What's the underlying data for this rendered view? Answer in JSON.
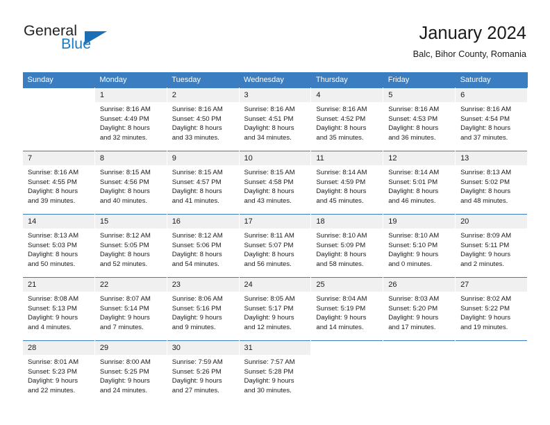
{
  "brand": {
    "name_dark": "General",
    "name_blue": "Blue",
    "accent_color": "#1c7bc0",
    "header_color": "#3a7dc0"
  },
  "header": {
    "title": "January 2024",
    "subtitle": "Balc, Bihor County, Romania"
  },
  "weekdays": [
    "Sunday",
    "Monday",
    "Tuesday",
    "Wednesday",
    "Thursday",
    "Friday",
    "Saturday"
  ],
  "weeks": [
    [
      {
        "day": "",
        "sunrise": "",
        "sunset": "",
        "daylight1": "",
        "daylight2": ""
      },
      {
        "day": "1",
        "sunrise": "Sunrise: 8:16 AM",
        "sunset": "Sunset: 4:49 PM",
        "daylight1": "Daylight: 8 hours",
        "daylight2": "and 32 minutes."
      },
      {
        "day": "2",
        "sunrise": "Sunrise: 8:16 AM",
        "sunset": "Sunset: 4:50 PM",
        "daylight1": "Daylight: 8 hours",
        "daylight2": "and 33 minutes."
      },
      {
        "day": "3",
        "sunrise": "Sunrise: 8:16 AM",
        "sunset": "Sunset: 4:51 PM",
        "daylight1": "Daylight: 8 hours",
        "daylight2": "and 34 minutes."
      },
      {
        "day": "4",
        "sunrise": "Sunrise: 8:16 AM",
        "sunset": "Sunset: 4:52 PM",
        "daylight1": "Daylight: 8 hours",
        "daylight2": "and 35 minutes."
      },
      {
        "day": "5",
        "sunrise": "Sunrise: 8:16 AM",
        "sunset": "Sunset: 4:53 PM",
        "daylight1": "Daylight: 8 hours",
        "daylight2": "and 36 minutes."
      },
      {
        "day": "6",
        "sunrise": "Sunrise: 8:16 AM",
        "sunset": "Sunset: 4:54 PM",
        "daylight1": "Daylight: 8 hours",
        "daylight2": "and 37 minutes."
      }
    ],
    [
      {
        "day": "7",
        "sunrise": "Sunrise: 8:16 AM",
        "sunset": "Sunset: 4:55 PM",
        "daylight1": "Daylight: 8 hours",
        "daylight2": "and 39 minutes."
      },
      {
        "day": "8",
        "sunrise": "Sunrise: 8:15 AM",
        "sunset": "Sunset: 4:56 PM",
        "daylight1": "Daylight: 8 hours",
        "daylight2": "and 40 minutes."
      },
      {
        "day": "9",
        "sunrise": "Sunrise: 8:15 AM",
        "sunset": "Sunset: 4:57 PM",
        "daylight1": "Daylight: 8 hours",
        "daylight2": "and 41 minutes."
      },
      {
        "day": "10",
        "sunrise": "Sunrise: 8:15 AM",
        "sunset": "Sunset: 4:58 PM",
        "daylight1": "Daylight: 8 hours",
        "daylight2": "and 43 minutes."
      },
      {
        "day": "11",
        "sunrise": "Sunrise: 8:14 AM",
        "sunset": "Sunset: 4:59 PM",
        "daylight1": "Daylight: 8 hours",
        "daylight2": "and 45 minutes."
      },
      {
        "day": "12",
        "sunrise": "Sunrise: 8:14 AM",
        "sunset": "Sunset: 5:01 PM",
        "daylight1": "Daylight: 8 hours",
        "daylight2": "and 46 minutes."
      },
      {
        "day": "13",
        "sunrise": "Sunrise: 8:13 AM",
        "sunset": "Sunset: 5:02 PM",
        "daylight1": "Daylight: 8 hours",
        "daylight2": "and 48 minutes."
      }
    ],
    [
      {
        "day": "14",
        "sunrise": "Sunrise: 8:13 AM",
        "sunset": "Sunset: 5:03 PM",
        "daylight1": "Daylight: 8 hours",
        "daylight2": "and 50 minutes."
      },
      {
        "day": "15",
        "sunrise": "Sunrise: 8:12 AM",
        "sunset": "Sunset: 5:05 PM",
        "daylight1": "Daylight: 8 hours",
        "daylight2": "and 52 minutes."
      },
      {
        "day": "16",
        "sunrise": "Sunrise: 8:12 AM",
        "sunset": "Sunset: 5:06 PM",
        "daylight1": "Daylight: 8 hours",
        "daylight2": "and 54 minutes."
      },
      {
        "day": "17",
        "sunrise": "Sunrise: 8:11 AM",
        "sunset": "Sunset: 5:07 PM",
        "daylight1": "Daylight: 8 hours",
        "daylight2": "and 56 minutes."
      },
      {
        "day": "18",
        "sunrise": "Sunrise: 8:10 AM",
        "sunset": "Sunset: 5:09 PM",
        "daylight1": "Daylight: 8 hours",
        "daylight2": "and 58 minutes."
      },
      {
        "day": "19",
        "sunrise": "Sunrise: 8:10 AM",
        "sunset": "Sunset: 5:10 PM",
        "daylight1": "Daylight: 9 hours",
        "daylight2": "and 0 minutes."
      },
      {
        "day": "20",
        "sunrise": "Sunrise: 8:09 AM",
        "sunset": "Sunset: 5:11 PM",
        "daylight1": "Daylight: 9 hours",
        "daylight2": "and 2 minutes."
      }
    ],
    [
      {
        "day": "21",
        "sunrise": "Sunrise: 8:08 AM",
        "sunset": "Sunset: 5:13 PM",
        "daylight1": "Daylight: 9 hours",
        "daylight2": "and 4 minutes."
      },
      {
        "day": "22",
        "sunrise": "Sunrise: 8:07 AM",
        "sunset": "Sunset: 5:14 PM",
        "daylight1": "Daylight: 9 hours",
        "daylight2": "and 7 minutes."
      },
      {
        "day": "23",
        "sunrise": "Sunrise: 8:06 AM",
        "sunset": "Sunset: 5:16 PM",
        "daylight1": "Daylight: 9 hours",
        "daylight2": "and 9 minutes."
      },
      {
        "day": "24",
        "sunrise": "Sunrise: 8:05 AM",
        "sunset": "Sunset: 5:17 PM",
        "daylight1": "Daylight: 9 hours",
        "daylight2": "and 12 minutes."
      },
      {
        "day": "25",
        "sunrise": "Sunrise: 8:04 AM",
        "sunset": "Sunset: 5:19 PM",
        "daylight1": "Daylight: 9 hours",
        "daylight2": "and 14 minutes."
      },
      {
        "day": "26",
        "sunrise": "Sunrise: 8:03 AM",
        "sunset": "Sunset: 5:20 PM",
        "daylight1": "Daylight: 9 hours",
        "daylight2": "and 17 minutes."
      },
      {
        "day": "27",
        "sunrise": "Sunrise: 8:02 AM",
        "sunset": "Sunset: 5:22 PM",
        "daylight1": "Daylight: 9 hours",
        "daylight2": "and 19 minutes."
      }
    ],
    [
      {
        "day": "28",
        "sunrise": "Sunrise: 8:01 AM",
        "sunset": "Sunset: 5:23 PM",
        "daylight1": "Daylight: 9 hours",
        "daylight2": "and 22 minutes."
      },
      {
        "day": "29",
        "sunrise": "Sunrise: 8:00 AM",
        "sunset": "Sunset: 5:25 PM",
        "daylight1": "Daylight: 9 hours",
        "daylight2": "and 24 minutes."
      },
      {
        "day": "30",
        "sunrise": "Sunrise: 7:59 AM",
        "sunset": "Sunset: 5:26 PM",
        "daylight1": "Daylight: 9 hours",
        "daylight2": "and 27 minutes."
      },
      {
        "day": "31",
        "sunrise": "Sunrise: 7:57 AM",
        "sunset": "Sunset: 5:28 PM",
        "daylight1": "Daylight: 9 hours",
        "daylight2": "and 30 minutes."
      },
      {
        "day": "",
        "sunrise": "",
        "sunset": "",
        "daylight1": "",
        "daylight2": ""
      },
      {
        "day": "",
        "sunrise": "",
        "sunset": "",
        "daylight1": "",
        "daylight2": ""
      },
      {
        "day": "",
        "sunrise": "",
        "sunset": "",
        "daylight1": "",
        "daylight2": ""
      }
    ]
  ]
}
